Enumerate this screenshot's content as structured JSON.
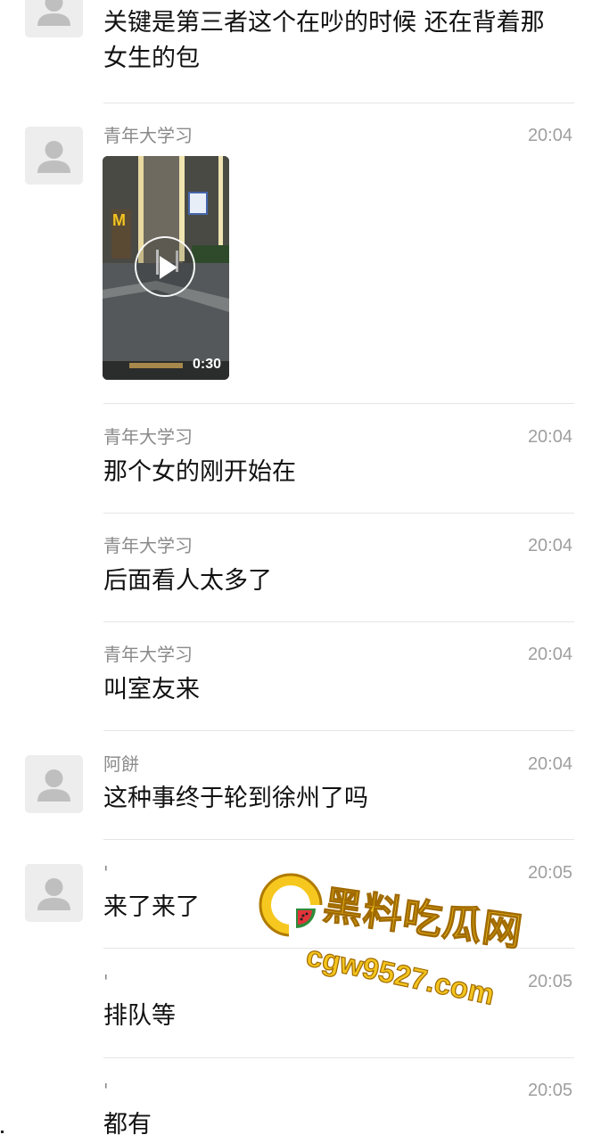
{
  "messages": [
    {
      "sender": "",
      "time": "",
      "text": "关键是第三者这个在吵的时候 还在背着那女生的包",
      "show_avatar": true
    },
    {
      "sender": "青年大学习",
      "time": "20:04",
      "type": "video",
      "duration": "0:30",
      "show_avatar": true
    },
    {
      "sender": "青年大学习",
      "time": "20:04",
      "text": "那个女的刚开始在",
      "show_avatar": false
    },
    {
      "sender": "青年大学习",
      "time": "20:04",
      "text": "后面看人太多了",
      "show_avatar": false
    },
    {
      "sender": "青年大学习",
      "time": "20:04",
      "text": "叫室友来",
      "show_avatar": false
    },
    {
      "sender": "阿餅",
      "time": "20:04",
      "text": "这种事终于轮到徐州了吗",
      "show_avatar": true
    },
    {
      "sender": "'",
      "time": "20:05",
      "text": "来了来了",
      "show_avatar": true
    },
    {
      "sender": "'",
      "time": "20:05",
      "text": "排队等",
      "show_avatar": false
    },
    {
      "sender": "'",
      "time": "20:05",
      "text": "都有",
      "show_avatar": false
    }
  ],
  "watermark": {
    "title": "黑料吃瓜网",
    "url": "cgw9527.com"
  },
  "colors": {
    "avatar_bg": "#ededed",
    "avatar_fg": "#bfbfbf",
    "divider": "#e5e5e5",
    "sender": "#8a8a8a",
    "time": "#9f9f9f",
    "message": "#111111",
    "watermark_fill": "#f3c41d"
  }
}
